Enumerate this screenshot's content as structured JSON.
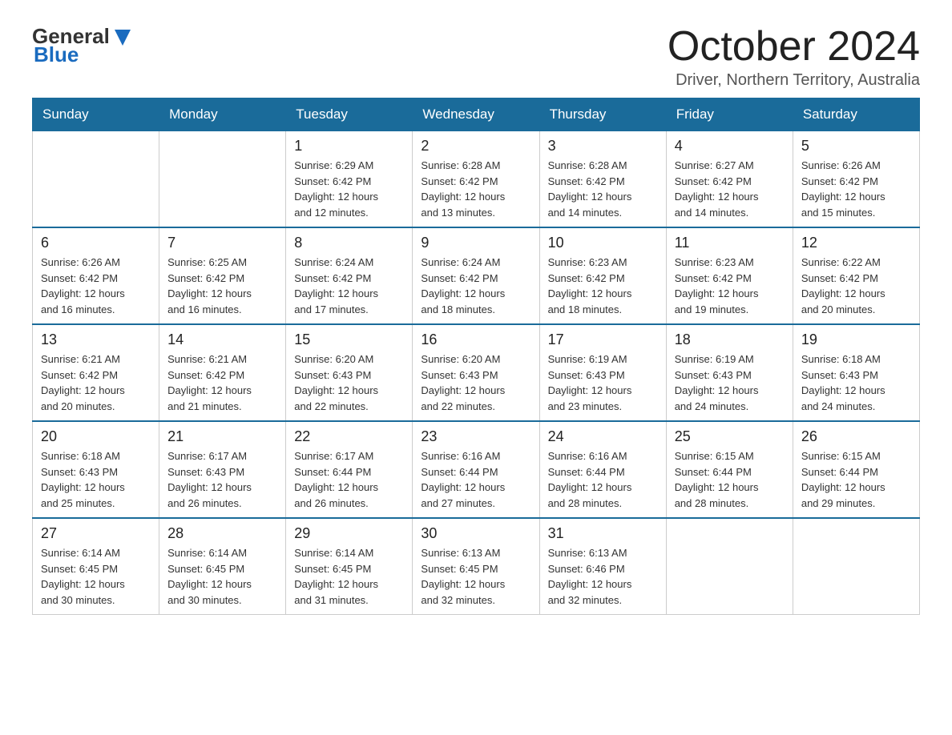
{
  "header": {
    "logo_general": "General",
    "logo_blue": "Blue",
    "month_title": "October 2024",
    "location": "Driver, Northern Territory, Australia"
  },
  "weekdays": [
    "Sunday",
    "Monday",
    "Tuesday",
    "Wednesday",
    "Thursday",
    "Friday",
    "Saturday"
  ],
  "weeks": [
    [
      {
        "day": "",
        "info": ""
      },
      {
        "day": "",
        "info": ""
      },
      {
        "day": "1",
        "info": "Sunrise: 6:29 AM\nSunset: 6:42 PM\nDaylight: 12 hours\nand 12 minutes."
      },
      {
        "day": "2",
        "info": "Sunrise: 6:28 AM\nSunset: 6:42 PM\nDaylight: 12 hours\nand 13 minutes."
      },
      {
        "day": "3",
        "info": "Sunrise: 6:28 AM\nSunset: 6:42 PM\nDaylight: 12 hours\nand 14 minutes."
      },
      {
        "day": "4",
        "info": "Sunrise: 6:27 AM\nSunset: 6:42 PM\nDaylight: 12 hours\nand 14 minutes."
      },
      {
        "day": "5",
        "info": "Sunrise: 6:26 AM\nSunset: 6:42 PM\nDaylight: 12 hours\nand 15 minutes."
      }
    ],
    [
      {
        "day": "6",
        "info": "Sunrise: 6:26 AM\nSunset: 6:42 PM\nDaylight: 12 hours\nand 16 minutes."
      },
      {
        "day": "7",
        "info": "Sunrise: 6:25 AM\nSunset: 6:42 PM\nDaylight: 12 hours\nand 16 minutes."
      },
      {
        "day": "8",
        "info": "Sunrise: 6:24 AM\nSunset: 6:42 PM\nDaylight: 12 hours\nand 17 minutes."
      },
      {
        "day": "9",
        "info": "Sunrise: 6:24 AM\nSunset: 6:42 PM\nDaylight: 12 hours\nand 18 minutes."
      },
      {
        "day": "10",
        "info": "Sunrise: 6:23 AM\nSunset: 6:42 PM\nDaylight: 12 hours\nand 18 minutes."
      },
      {
        "day": "11",
        "info": "Sunrise: 6:23 AM\nSunset: 6:42 PM\nDaylight: 12 hours\nand 19 minutes."
      },
      {
        "day": "12",
        "info": "Sunrise: 6:22 AM\nSunset: 6:42 PM\nDaylight: 12 hours\nand 20 minutes."
      }
    ],
    [
      {
        "day": "13",
        "info": "Sunrise: 6:21 AM\nSunset: 6:42 PM\nDaylight: 12 hours\nand 20 minutes."
      },
      {
        "day": "14",
        "info": "Sunrise: 6:21 AM\nSunset: 6:42 PM\nDaylight: 12 hours\nand 21 minutes."
      },
      {
        "day": "15",
        "info": "Sunrise: 6:20 AM\nSunset: 6:43 PM\nDaylight: 12 hours\nand 22 minutes."
      },
      {
        "day": "16",
        "info": "Sunrise: 6:20 AM\nSunset: 6:43 PM\nDaylight: 12 hours\nand 22 minutes."
      },
      {
        "day": "17",
        "info": "Sunrise: 6:19 AM\nSunset: 6:43 PM\nDaylight: 12 hours\nand 23 minutes."
      },
      {
        "day": "18",
        "info": "Sunrise: 6:19 AM\nSunset: 6:43 PM\nDaylight: 12 hours\nand 24 minutes."
      },
      {
        "day": "19",
        "info": "Sunrise: 6:18 AM\nSunset: 6:43 PM\nDaylight: 12 hours\nand 24 minutes."
      }
    ],
    [
      {
        "day": "20",
        "info": "Sunrise: 6:18 AM\nSunset: 6:43 PM\nDaylight: 12 hours\nand 25 minutes."
      },
      {
        "day": "21",
        "info": "Sunrise: 6:17 AM\nSunset: 6:43 PM\nDaylight: 12 hours\nand 26 minutes."
      },
      {
        "day": "22",
        "info": "Sunrise: 6:17 AM\nSunset: 6:44 PM\nDaylight: 12 hours\nand 26 minutes."
      },
      {
        "day": "23",
        "info": "Sunrise: 6:16 AM\nSunset: 6:44 PM\nDaylight: 12 hours\nand 27 minutes."
      },
      {
        "day": "24",
        "info": "Sunrise: 6:16 AM\nSunset: 6:44 PM\nDaylight: 12 hours\nand 28 minutes."
      },
      {
        "day": "25",
        "info": "Sunrise: 6:15 AM\nSunset: 6:44 PM\nDaylight: 12 hours\nand 28 minutes."
      },
      {
        "day": "26",
        "info": "Sunrise: 6:15 AM\nSunset: 6:44 PM\nDaylight: 12 hours\nand 29 minutes."
      }
    ],
    [
      {
        "day": "27",
        "info": "Sunrise: 6:14 AM\nSunset: 6:45 PM\nDaylight: 12 hours\nand 30 minutes."
      },
      {
        "day": "28",
        "info": "Sunrise: 6:14 AM\nSunset: 6:45 PM\nDaylight: 12 hours\nand 30 minutes."
      },
      {
        "day": "29",
        "info": "Sunrise: 6:14 AM\nSunset: 6:45 PM\nDaylight: 12 hours\nand 31 minutes."
      },
      {
        "day": "30",
        "info": "Sunrise: 6:13 AM\nSunset: 6:45 PM\nDaylight: 12 hours\nand 32 minutes."
      },
      {
        "day": "31",
        "info": "Sunrise: 6:13 AM\nSunset: 6:46 PM\nDaylight: 12 hours\nand 32 minutes."
      },
      {
        "day": "",
        "info": ""
      },
      {
        "day": "",
        "info": ""
      }
    ]
  ]
}
